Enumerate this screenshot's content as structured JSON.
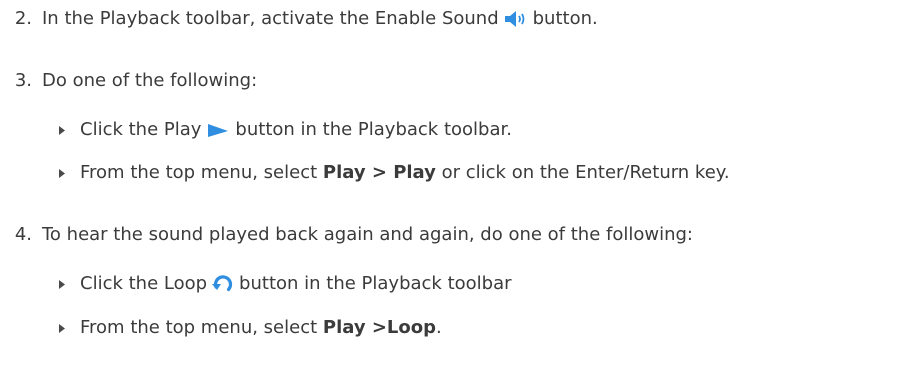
{
  "steps": [
    {
      "number": "2.",
      "before_icon": "In the Playback toolbar, activate the Enable Sound",
      "icon": "speaker-icon",
      "after_icon": "button."
    },
    {
      "number": "3.",
      "text": "Do one of the following:",
      "bullets": [
        {
          "before_icon": "Click the Play",
          "icon": "play-icon",
          "after_icon": "button in the Playback toolbar."
        },
        {
          "before_bold": "From the top menu, select",
          "bold": "Play > Play",
          "after_bold": "or click on the Enter/Return key."
        }
      ]
    },
    {
      "number": "4.",
      "text": "To hear the sound played back again and again, do one of the following:",
      "bullets": [
        {
          "before_icon": "Click the Loop",
          "icon": "loop-icon",
          "after_icon": "button in the Playback toolbar"
        },
        {
          "before_bold": "From the top menu, select",
          "bold": "Play >Loop",
          "after_bold": "."
        }
      ]
    }
  ],
  "colors": {
    "text": "#3b3b3b",
    "icon_blue": "#2f8ee0",
    "bullet": "#4a4a4a"
  }
}
